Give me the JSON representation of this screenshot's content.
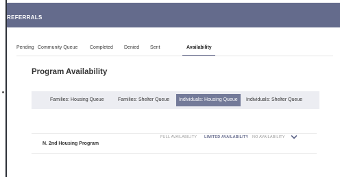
{
  "header": {
    "title": "REFERRALS"
  },
  "tabs": [
    {
      "label": "Pending",
      "active": false
    },
    {
      "label": "Community Queue",
      "active": false
    },
    {
      "label": "Completed",
      "active": false
    },
    {
      "label": "Denied",
      "active": false
    },
    {
      "label": "Sent",
      "active": false
    },
    {
      "label": "Availability",
      "active": true
    }
  ],
  "section": {
    "title": "Program Availability"
  },
  "filters": [
    {
      "label": "Families: Housing Queue",
      "active": false
    },
    {
      "label": "Families: Shelter Queue",
      "active": false
    },
    {
      "label": "Individuals: Housing Queue",
      "active": true
    },
    {
      "label": "Individuals: Shelter Queue",
      "active": false
    }
  ],
  "program": {
    "name": "N. 2nd Housing Program",
    "legend": {
      "full": "FULL AVAILABILITY",
      "limited": "LIMITED AVAILABILITY",
      "none": "NO AVAILABILITY"
    },
    "expand_icon": "chevron-down-icon"
  },
  "colors": {
    "header_bg": "#646b8c",
    "active_filter_bg": "#737a99",
    "accent": "#5d6488"
  }
}
